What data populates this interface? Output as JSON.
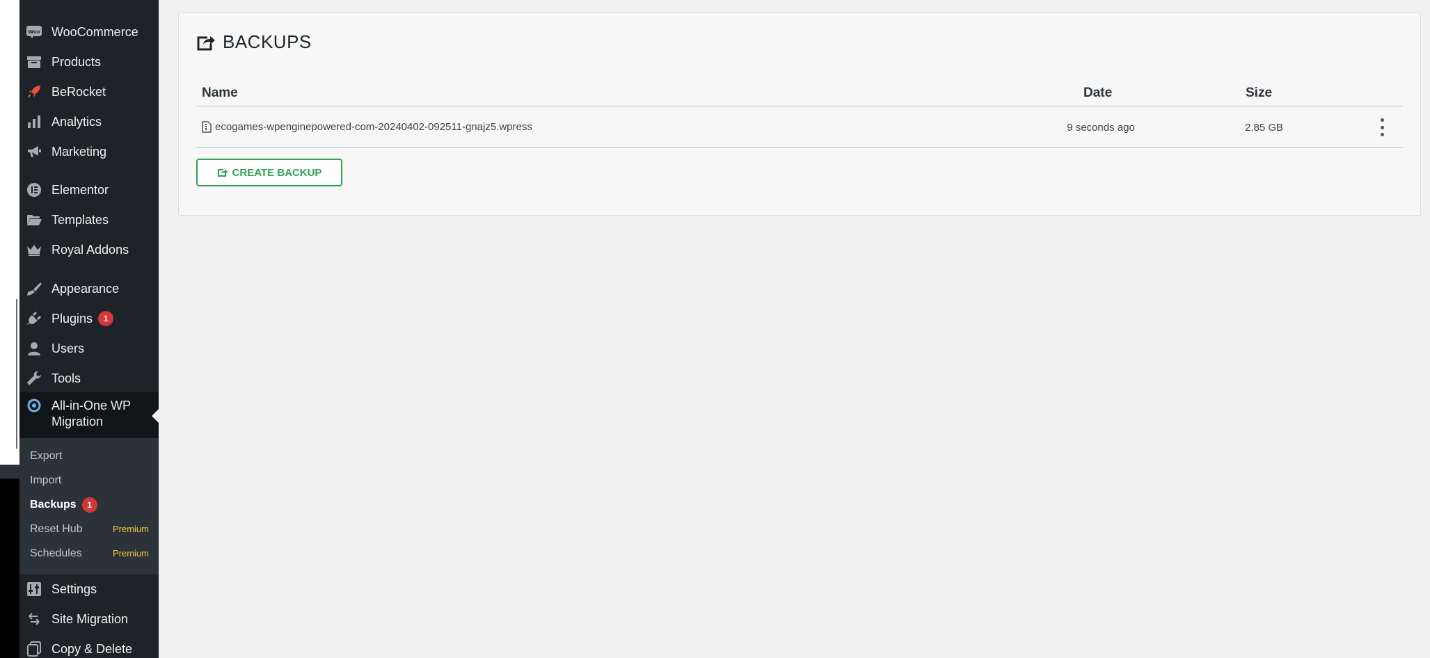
{
  "sidebar": {
    "items": [
      {
        "label": "WooCommerce",
        "icon": "woo-icon"
      },
      {
        "label": "Products",
        "icon": "archive-icon"
      },
      {
        "label": "BeRocket",
        "icon": "rocket-icon"
      },
      {
        "label": "Analytics",
        "icon": "bar-chart-icon"
      },
      {
        "label": "Marketing",
        "icon": "megaphone-icon"
      },
      {
        "label": "Elementor",
        "icon": "elementor-icon"
      },
      {
        "label": "Templates",
        "icon": "folder-icon"
      },
      {
        "label": "Royal Addons",
        "icon": "crown-icon"
      },
      {
        "label": "Appearance",
        "icon": "brush-icon"
      },
      {
        "label": "Plugins",
        "icon": "plug-icon",
        "badge": "1"
      },
      {
        "label": "Users",
        "icon": "user-icon"
      },
      {
        "label": "Tools",
        "icon": "wrench-icon"
      },
      {
        "label": "All-in-One WP Migration",
        "icon": "migration-icon"
      },
      {
        "label": "Settings",
        "icon": "settings-icon"
      },
      {
        "label": "Site Migration",
        "icon": "arrows-swap-icon"
      },
      {
        "label": "Copy & Delete",
        "icon": "copy-icon"
      }
    ],
    "submenu": [
      {
        "label": "Export"
      },
      {
        "label": "Import"
      },
      {
        "label": "Backups",
        "badge": "1"
      },
      {
        "label": "Reset Hub",
        "tag": "Premium"
      },
      {
        "label": "Schedules",
        "tag": "Premium"
      }
    ]
  },
  "backups": {
    "title": "BACKUPS",
    "columns": {
      "name": "Name",
      "date": "Date",
      "size": "Size"
    },
    "rows": [
      {
        "name": "ecogames-wpenginepowered-com-20240402-092511-gnajz5.wpress",
        "date": "9 seconds ago",
        "size": "2.85 GB"
      }
    ],
    "create_label": "CREATE BACKUP"
  },
  "colors": {
    "sidebar_bg": "#1d2327",
    "submenu_bg": "#2c3338",
    "badge": "#d63638",
    "premium": "#f0c33c",
    "accent_green": "#2ea44f"
  }
}
